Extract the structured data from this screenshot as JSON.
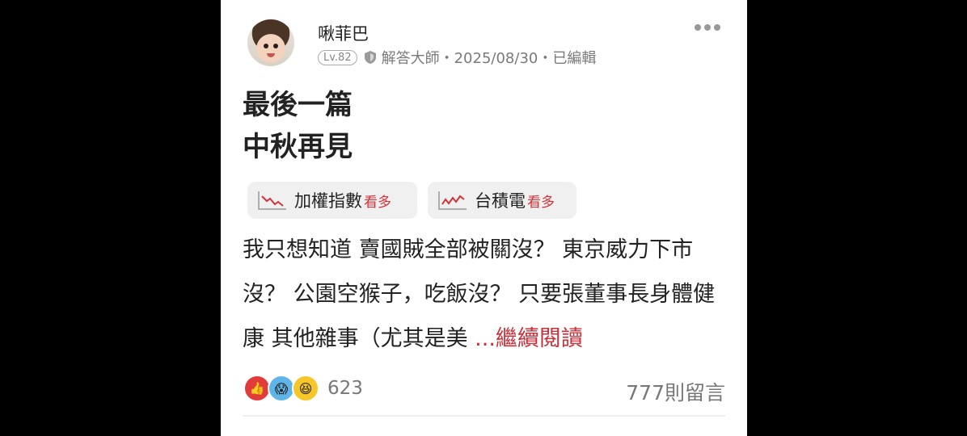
{
  "post": {
    "username": "啾菲巴",
    "level": "Lv.82",
    "meta_text": "解答大師・2025/08/30・已編輯",
    "title_line1": "最後一篇",
    "title_line2": "中秋再見",
    "chips": [
      {
        "name": "加權指數",
        "more": "看多"
      },
      {
        "name": "台積電",
        "more": "看多"
      }
    ],
    "body": "我只想知道 賣國賊全部被關沒？ 東京威力下市沒？ 公園空猴子，吃飯沒？ 只要張董事長身體健康 其他雜事（尤其是美 ",
    "read_more": "...繼續閱讀",
    "reaction_count": "623",
    "comments": "777則留言"
  },
  "icons": [
    "more-icon",
    "shield-icon",
    "stock-down-icon",
    "stock-up-icon",
    "like-icon",
    "wow-icon",
    "haha-icon"
  ],
  "colors": {
    "accent_red": "#d0343a"
  }
}
